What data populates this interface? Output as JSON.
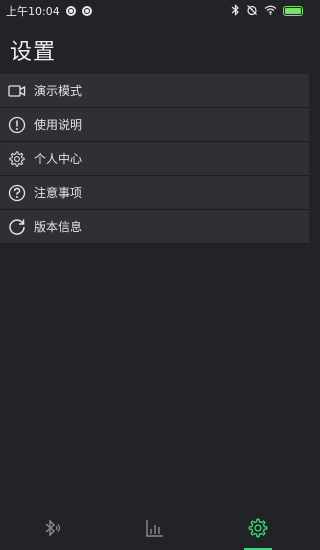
{
  "status_bar": {
    "time": "上午10:04",
    "battery_fill_fraction": 1.0,
    "battery_color": "#7be06b",
    "icons": [
      "notification-dot-icon",
      "notification-dot-icon",
      "bluetooth-icon",
      "alarm-off-icon",
      "wifi-icon",
      "battery-icon"
    ]
  },
  "header": {
    "title": "设置"
  },
  "menu": {
    "items": [
      {
        "label": "演示模式",
        "icon": "video-camera-icon"
      },
      {
        "label": "使用说明",
        "icon": "info-exclamation-icon"
      },
      {
        "label": "个人中心",
        "icon": "gear-icon"
      },
      {
        "label": "注意事项",
        "icon": "question-icon"
      },
      {
        "label": "版本信息",
        "icon": "refresh-icon"
      }
    ]
  },
  "bottom_nav": {
    "tabs": [
      {
        "icon": "bluetooth-icon",
        "active": false
      },
      {
        "icon": "bar-chart-icon",
        "active": false
      },
      {
        "icon": "gear-icon",
        "active": true
      }
    ],
    "active_color": "#3ed67a",
    "inactive_color": "#8a8b90"
  }
}
